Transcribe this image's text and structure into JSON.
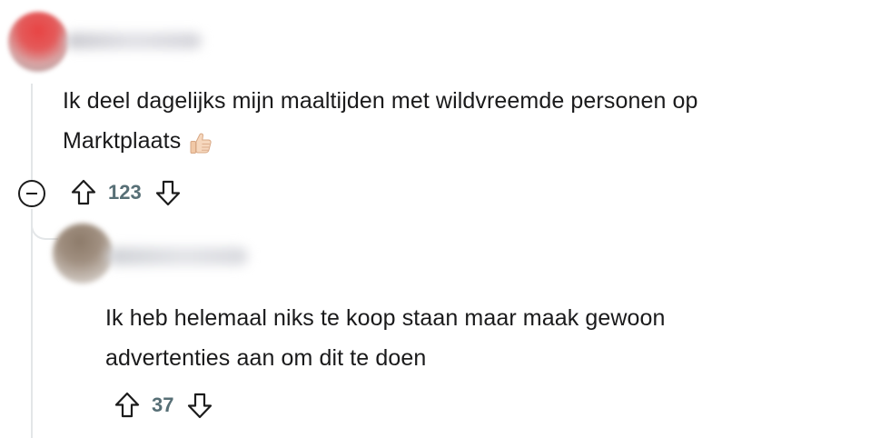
{
  "thread": {
    "comment": {
      "avatar_color": "#e84444",
      "text_line1": "Ik deel dagelijks mijn maaltijden met wildvreemde personen op",
      "text_line2": "Marktplaats",
      "emoji_icon": "thumbs-up-icon",
      "score": "123"
    },
    "reply": {
      "avatar_color": "#8d7b6a",
      "text_line1": "Ik heb helemaal niks te koop staan maar maak gewoon",
      "text_line2": "advertenties aan om dit te doen",
      "score": "37"
    }
  },
  "colors": {
    "text": "#1a1a1b",
    "vote_count": "#576f76",
    "thread_line": "#e3e6e8"
  }
}
